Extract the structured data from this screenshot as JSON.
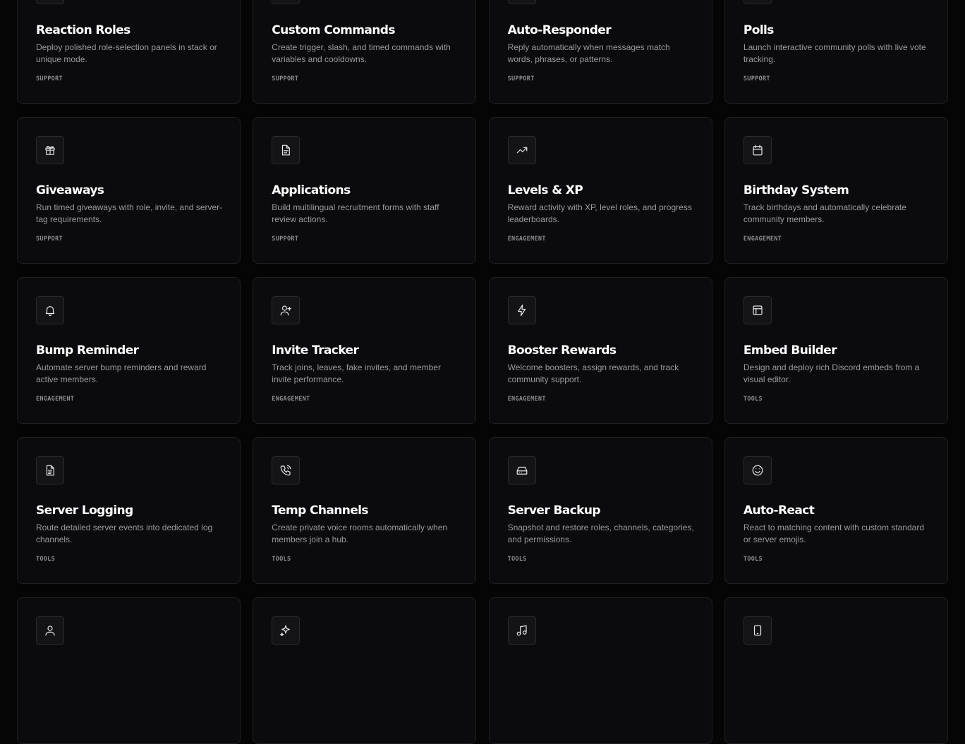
{
  "cards": [
    {
      "title": "Reaction Roles",
      "description": "Deploy polished role-selection panels in stack or unique mode.",
      "tag": "SUPPORT",
      "icon": "tag-icon"
    },
    {
      "title": "Custom Commands",
      "description": "Create trigger, slash, and timed commands with variables and cooldowns.",
      "tag": "SUPPORT",
      "icon": "terminal-icon"
    },
    {
      "title": "Auto-Responder",
      "description": "Reply automatically when messages match words, phrases, or patterns.",
      "tag": "SUPPORT",
      "icon": "message-icon"
    },
    {
      "title": "Polls",
      "description": "Launch interactive community polls with live vote tracking.",
      "tag": "SUPPORT",
      "icon": "chart-icon"
    },
    {
      "title": "Giveaways",
      "description": "Run timed giveaways with role, invite, and server-tag requirements.",
      "tag": "SUPPORT",
      "icon": "gift-icon"
    },
    {
      "title": "Applications",
      "description": "Build multilingual recruitment forms with staff review actions.",
      "tag": "SUPPORT",
      "icon": "document-icon"
    },
    {
      "title": "Levels & XP",
      "description": "Reward activity with XP, level roles, and progress leaderboards.",
      "tag": "ENGAGEMENT",
      "icon": "trending-up-icon"
    },
    {
      "title": "Birthday System",
      "description": "Track birthdays and automatically celebrate community members.",
      "tag": "ENGAGEMENT",
      "icon": "calendar-icon"
    },
    {
      "title": "Bump Reminder",
      "description": "Automate server bump reminders and reward active members.",
      "tag": "ENGAGEMENT",
      "icon": "bell-icon"
    },
    {
      "title": "Invite Tracker",
      "description": "Track joins, leaves, fake invites, and member invite performance.",
      "tag": "ENGAGEMENT",
      "icon": "user-plus-icon"
    },
    {
      "title": "Booster Rewards",
      "description": "Welcome boosters, assign rewards, and track community support.",
      "tag": "ENGAGEMENT",
      "icon": "lightning-icon"
    },
    {
      "title": "Embed Builder",
      "description": "Design and deploy rich Discord embeds from a visual editor.",
      "tag": "TOOLS",
      "icon": "layout-icon"
    },
    {
      "title": "Server Logging",
      "description": "Route detailed server events into dedicated log channels.",
      "tag": "TOOLS",
      "icon": "log-file-icon"
    },
    {
      "title": "Temp Channels",
      "description": "Create private voice rooms automatically when members join a hub.",
      "tag": "TOOLS",
      "icon": "phone-icon"
    },
    {
      "title": "Server Backup",
      "description": "Snapshot and restore roles, channels, categories, and permissions.",
      "tag": "TOOLS",
      "icon": "hard-drive-icon"
    },
    {
      "title": "Auto-React",
      "description": "React to matching content with custom standard or server emojis.",
      "tag": "TOOLS",
      "icon": "smile-icon"
    },
    {
      "title": "",
      "description": "",
      "tag": "",
      "icon": "user-icon"
    },
    {
      "title": "",
      "description": "",
      "tag": "",
      "icon": "sparkles-icon"
    },
    {
      "title": "",
      "description": "",
      "tag": "",
      "icon": "music-icon"
    },
    {
      "title": "",
      "description": "",
      "tag": "",
      "icon": "tablet-icon"
    }
  ]
}
